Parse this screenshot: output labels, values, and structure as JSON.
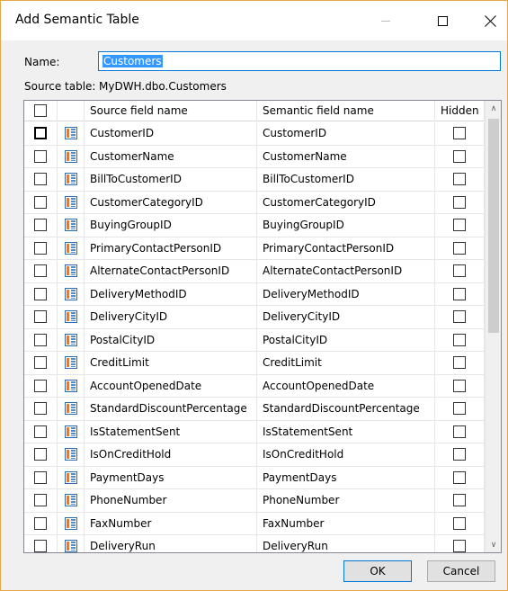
{
  "window": {
    "title": "Add Semantic Table"
  },
  "form": {
    "name_label": "Name:",
    "name_value": "Customers",
    "source_label": "Source table:",
    "source_value": "MyDWH.dbo.Customers"
  },
  "grid": {
    "headers": {
      "source": "Source field name",
      "semantic": "Semantic field name",
      "hidden": "Hidden"
    },
    "rows": [
      {
        "source": "CustomerID",
        "semantic": "CustomerID"
      },
      {
        "source": "CustomerName",
        "semantic": "CustomerName"
      },
      {
        "source": "BillToCustomerID",
        "semantic": "BillToCustomerID"
      },
      {
        "source": "CustomerCategoryID",
        "semantic": "CustomerCategoryID"
      },
      {
        "source": "BuyingGroupID",
        "semantic": "BuyingGroupID"
      },
      {
        "source": "PrimaryContactPersonID",
        "semantic": "PrimaryContactPersonID"
      },
      {
        "source": "AlternateContactPersonID",
        "semantic": "AlternateContactPersonID"
      },
      {
        "source": "DeliveryMethodID",
        "semantic": "DeliveryMethodID"
      },
      {
        "source": "DeliveryCityID",
        "semantic": "DeliveryCityID"
      },
      {
        "source": "PostalCityID",
        "semantic": "PostalCityID"
      },
      {
        "source": "CreditLimit",
        "semantic": "CreditLimit"
      },
      {
        "source": "AccountOpenedDate",
        "semantic": "AccountOpenedDate"
      },
      {
        "source": "StandardDiscountPercentage",
        "semantic": "StandardDiscountPercentage"
      },
      {
        "source": "IsStatementSent",
        "semantic": "IsStatementSent"
      },
      {
        "source": "IsOnCreditHold",
        "semantic": "IsOnCreditHold"
      },
      {
        "source": "PaymentDays",
        "semantic": "PaymentDays"
      },
      {
        "source": "PhoneNumber",
        "semantic": "PhoneNumber"
      },
      {
        "source": "FaxNumber",
        "semantic": "FaxNumber"
      },
      {
        "source": "DeliveryRun",
        "semantic": "DeliveryRun"
      }
    ]
  },
  "buttons": {
    "ok": "OK",
    "cancel": "Cancel"
  },
  "icons": {
    "field": "table-field-icon",
    "minimize": "minimize-icon",
    "maximize": "maximize-icon",
    "close": "close-icon",
    "scroll_up": "chevron-up-icon",
    "scroll_down": "chevron-down-icon"
  },
  "colors": {
    "accent": "#0078d7",
    "selection": "#3399ff",
    "frame": "#e8a84a"
  }
}
